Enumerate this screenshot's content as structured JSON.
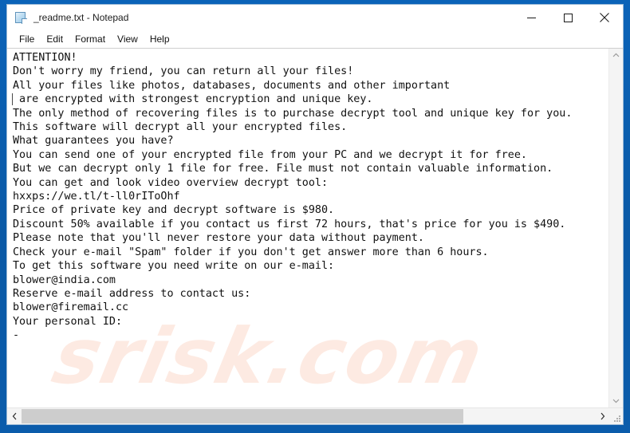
{
  "window": {
    "title": "_readme.txt - Notepad",
    "icon": "notepad-document-icon",
    "controls": {
      "minimize_label": "Minimize",
      "maximize_label": "Maximize",
      "close_label": "Close"
    },
    "accent_color": "#0b5cab",
    "background_color": "#ffffff"
  },
  "menu": {
    "items": [
      {
        "label": "File"
      },
      {
        "label": "Edit"
      },
      {
        "label": "Format"
      },
      {
        "label": "View"
      },
      {
        "label": "Help"
      }
    ]
  },
  "document": {
    "filename": "_readme.txt",
    "watermark": "srisk.com",
    "lines": [
      "ATTENTION!",
      "Don't worry my friend, you can return all your files!",
      "All your files like photos, databases, documents and other important",
      " are encrypted with strongest encryption and unique key.",
      "The only method of recovering files is to purchase decrypt tool and unique key for you.",
      "This software will decrypt all your encrypted files.",
      "What guarantees you have?",
      "You can send one of your encrypted file from your PC and we decrypt it for free.",
      "But we can decrypt only 1 file for free. File must not contain valuable information.",
      "You can get and look video overview decrypt tool:",
      "hxxps://we.tl/t-ll0rIToOhf",
      "Price of private key and decrypt software is $980.",
      "Discount 50% available if you contact us first 72 hours, that's price for you is $490.",
      "Please note that you'll never restore your data without payment.",
      "Check your e-mail \"Spam\" folder if you don't get answer more than 6 hours.",
      "To get this software you need write on our e-mail:",
      "blower@india.com",
      "Reserve e-mail address to contact us:",
      "blower@firemail.cc",
      "Your personal ID:",
      "-"
    ],
    "caret_line_index": 3
  },
  "scrollbars": {
    "vertical": {
      "up_arrow": "chevron-up-icon",
      "down_arrow": "chevron-down-icon",
      "thumb_visible": false
    },
    "horizontal": {
      "left_arrow": "chevron-left-icon",
      "right_arrow": "chevron-right-icon",
      "thumb_percent": 77
    },
    "resize_grip": "resize-grip-icon"
  }
}
